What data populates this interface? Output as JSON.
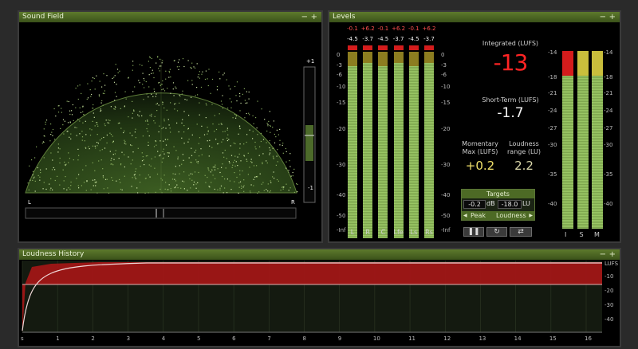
{
  "sound_field": {
    "title": "Sound Field",
    "scale_top": "+1",
    "scale_bottom": "-1",
    "left_label": "L",
    "right_label": "R"
  },
  "levels": {
    "title": "Levels",
    "channels": [
      {
        "label": "L",
        "peak": "-0.1",
        "true_peak": "+6.2",
        "rms": "-4.5",
        "level_db": -4.5
      },
      {
        "label": "R",
        "peak": "+6.2",
        "true_peak": "+6.2",
        "rms": "-3.7",
        "level_db": -3.7
      },
      {
        "label": "C",
        "peak": "-0.1",
        "true_peak": "+6.2",
        "rms": "-4.5",
        "level_db": -4.5
      },
      {
        "label": "Lfe",
        "peak": "+6.2",
        "true_peak": "+6.2",
        "rms": "-3.7",
        "level_db": -3.7
      },
      {
        "label": "Ls",
        "peak": "-0.1",
        "true_peak": "+6.2",
        "rms": "-4.5",
        "level_db": -4.5
      },
      {
        "label": "Rs",
        "peak": "+6.2",
        "true_peak": "+6.2",
        "rms": "-3.7",
        "level_db": -3.7
      }
    ],
    "peak_row": [
      "-0.1",
      "+6.2",
      "-0.1",
      "+6.2",
      "-0.1",
      "+6.2"
    ],
    "rms_row": [
      "-4.5",
      "-3.7",
      "-4.5",
      "-3.7",
      "-4.5",
      "-3.7"
    ],
    "scale_left": [
      "0",
      "-3",
      "-6",
      "-10",
      "-15",
      "-20",
      "-30",
      "-40",
      "-50",
      "-Inf"
    ],
    "scale_right": [
      "0",
      "-3",
      "-6",
      "-10",
      "-15",
      "-20",
      "-30",
      "-40",
      "-50",
      "-Inf"
    ],
    "integrated_label": "Integrated (LUFS)",
    "integrated_value": "-13",
    "short_term_label": "Short-Term (LUFS)",
    "short_term_value": "-1.7",
    "momentary_label": "Momentary Max (LUFS)",
    "momentary_value": "+0.2",
    "loudness_range_label": "Loudness range (LU)",
    "loudness_range_value": "2.2",
    "targets_title": "Targets",
    "target_peak": "-0.2",
    "target_peak_unit": "dB",
    "target_loudness": "-18.0",
    "target_loudness_unit": "LU",
    "peak_label": "Peak",
    "loudness_label": "Loudness",
    "ism_labels": [
      "I",
      "S",
      "M"
    ],
    "ism_scale": [
      "-14",
      "-18",
      "-21",
      "-24",
      "-27",
      "-30",
      "-35",
      "-40"
    ]
  },
  "history": {
    "title": "Loudness History",
    "unit": "LUFS",
    "y_ticks": [
      "-10",
      "-20",
      "-30",
      "-40"
    ],
    "x_ticks": [
      "s",
      "1",
      "2",
      "3",
      "4",
      "5",
      "6",
      "7",
      "8",
      "9",
      "10",
      "11",
      "12",
      "13",
      "14",
      "15",
      "16"
    ]
  },
  "colors": {
    "panel_title": "#4b6a22",
    "meter_green": "#8fbf5a",
    "meter_yellow": "#c5b93b",
    "meter_red": "#d41c1c",
    "history_red": "#a01616"
  }
}
